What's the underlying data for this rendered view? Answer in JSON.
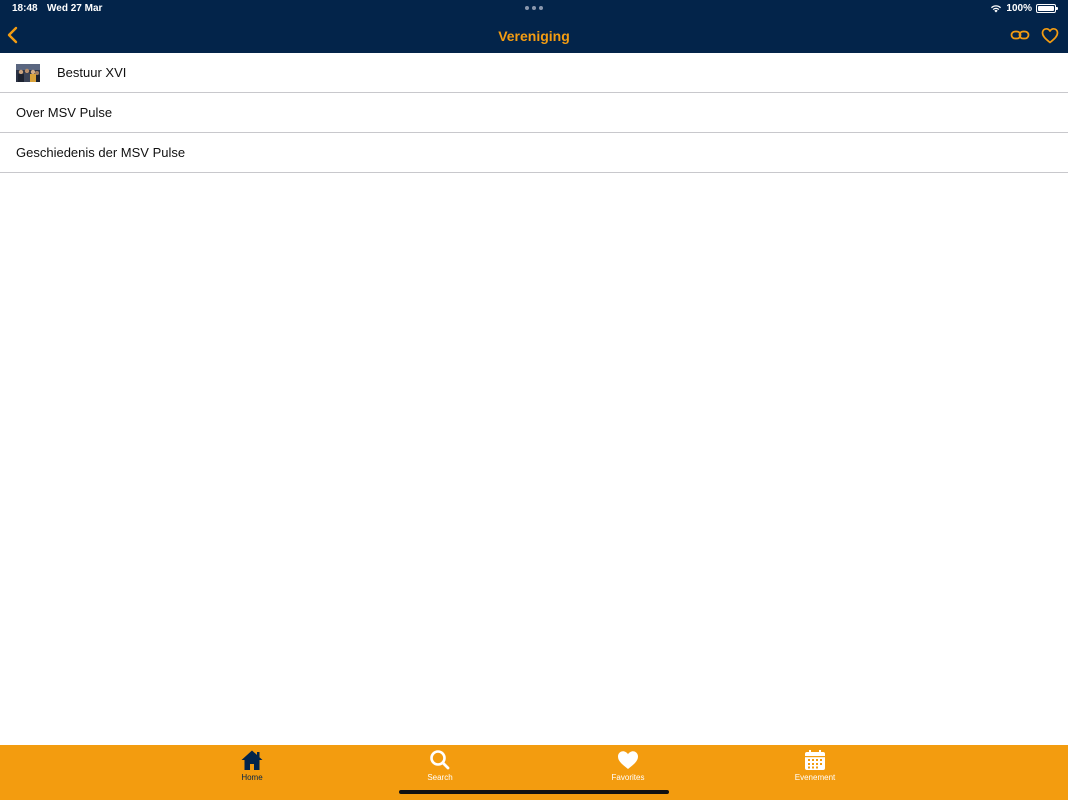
{
  "status_bar": {
    "time": "18:48",
    "date": "Wed 27 Mar",
    "battery": "100%"
  },
  "nav": {
    "title": "Vereniging"
  },
  "list": {
    "items": [
      {
        "label": "Bestuur XVI",
        "has_thumbnail": true
      },
      {
        "label": "Over MSV Pulse"
      },
      {
        "label": "Geschiedenis der MSV Pulse"
      }
    ]
  },
  "tabbar": {
    "tabs": [
      {
        "label": "Home",
        "icon": "home-icon",
        "selected": true
      },
      {
        "label": "Search",
        "icon": "search-icon"
      },
      {
        "label": "Favorites",
        "icon": "heart-icon"
      },
      {
        "label": "Evenement",
        "icon": "calendar-icon"
      }
    ]
  },
  "colors": {
    "navbar_bg": "#03244a",
    "accent": "#f39c12",
    "tabbar_bg": "#f39c0f"
  }
}
